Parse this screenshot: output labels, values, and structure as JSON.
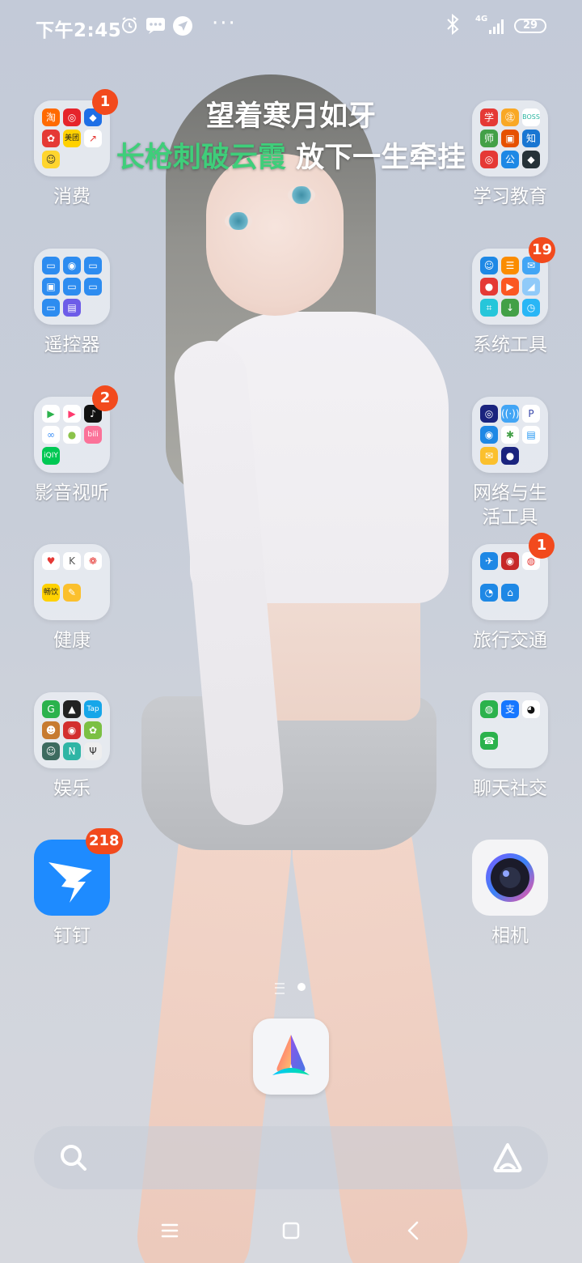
{
  "status_bar": {
    "time": "下午2:45",
    "network": "4G",
    "battery": "29",
    "more": "···"
  },
  "lyrics": {
    "line1": "望着寒月如牙",
    "line2_highlight": "长枪刺破云霞",
    "line2_rest": " 放下一生牵挂"
  },
  "apps": [
    {
      "label": "消费",
      "badge": "1"
    },
    {
      "label": "学习教育",
      "badge": ""
    },
    {
      "label": "遥控器",
      "badge": ""
    },
    {
      "label": "系统工具",
      "badge": "19"
    },
    {
      "label": "影音视听",
      "badge": "2"
    },
    {
      "label": "网络与生活工具",
      "badge": ""
    },
    {
      "label": "健康",
      "badge": ""
    },
    {
      "label": "旅行交通",
      "badge": "1"
    },
    {
      "label": "娱乐",
      "badge": ""
    },
    {
      "label": "聊天社交",
      "badge": ""
    },
    {
      "label": "钉钉",
      "badge": "218"
    },
    {
      "label": "相机",
      "badge": ""
    }
  ],
  "folder_glyphs": {
    "xiaofei": [
      "淘",
      "",
      "",
      "",
      "美团",
      "",
      ""
    ],
    "xuexi": [
      "学",
      "",
      "BOSS",
      "师",
      "",
      "知",
      "",
      "公",
      ""
    ],
    "jiankang": [
      "♥",
      "K",
      "",
      "畅饮",
      "",
      ""
    ],
    "yule": [
      "G",
      "",
      "Tap",
      "",
      "",
      "",
      "",
      "N",
      ""
    ]
  },
  "colors": {
    "badge": "#f24a1d",
    "lyric_highlight": "#3fce7a",
    "dingtalk": "#1e8bff"
  }
}
